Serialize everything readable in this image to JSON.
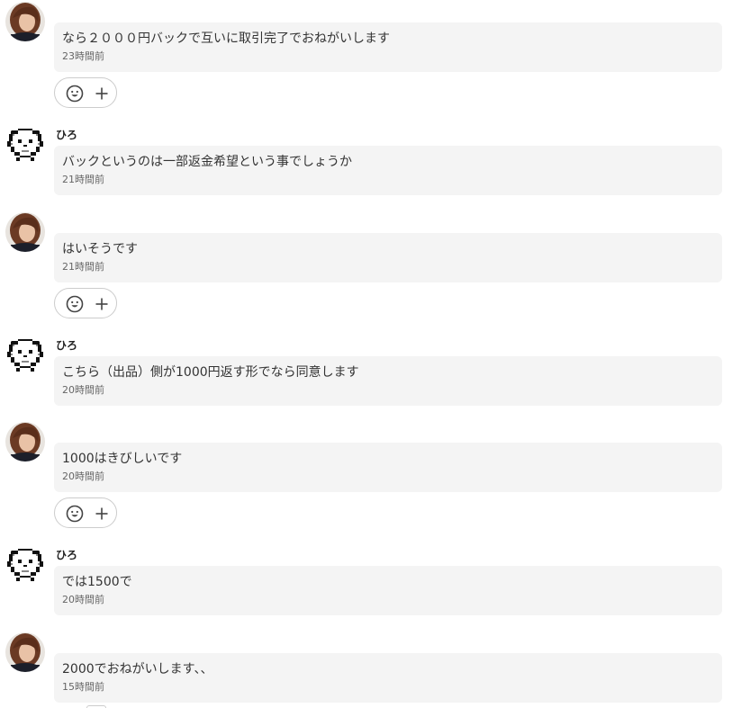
{
  "thread": {
    "messages": [
      {
        "from": "self",
        "sender": "",
        "text": "なら２０００円バックで互いに取引完了でおねがいします",
        "time": "23時間前",
        "show_reactions": true
      },
      {
        "from": "other",
        "sender": "ひろ",
        "text": "バックというのは一部返金希望という事でしょうか",
        "time": "21時間前",
        "show_reactions": false
      },
      {
        "from": "self",
        "sender": "",
        "text": "はいそうです",
        "time": "21時間前",
        "show_reactions": true
      },
      {
        "from": "other",
        "sender": "ひろ",
        "text": "こちら（出品）側が1000円返す形でなら同意します",
        "time": "20時間前",
        "show_reactions": false
      },
      {
        "from": "self",
        "sender": "",
        "text": "1000はきびしいです",
        "time": "20時間前",
        "show_reactions": true
      },
      {
        "from": "other",
        "sender": "ひろ",
        "text": "では1500で",
        "time": "20時間前",
        "show_reactions": false
      },
      {
        "from": "self",
        "sender": "",
        "text": "2000でおねがいします、、",
        "time": "15時間前",
        "show_reactions": false
      }
    ],
    "icons": {
      "reaction": "smiley-face-icon",
      "add_reaction": "plus-icon"
    }
  },
  "colors": {
    "bubble_bg": "#f4f4f4",
    "text": "#333333",
    "time": "#666666",
    "border": "#cccccc"
  }
}
